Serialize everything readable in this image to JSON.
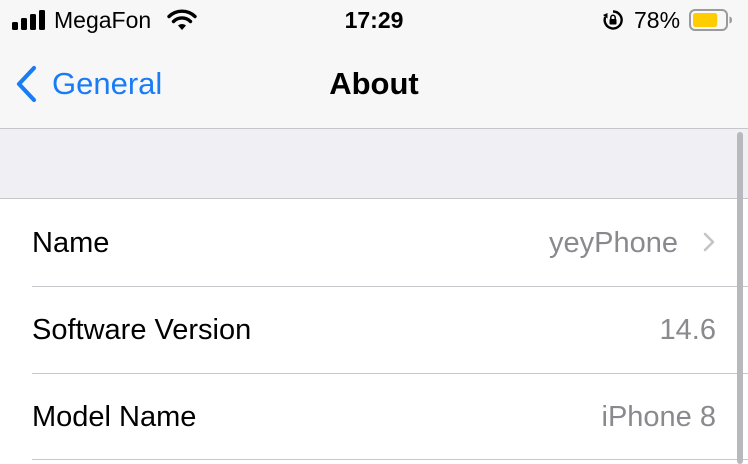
{
  "status_bar": {
    "carrier": "MegaFon",
    "time": "17:29",
    "battery_percent": "78%",
    "battery_level": 0.78,
    "battery_color": "#ffcc00",
    "icons": [
      "signal-icon",
      "wifi-icon",
      "rotation-lock-icon",
      "battery-icon"
    ]
  },
  "nav": {
    "back_label": "General",
    "title": "About",
    "accent_color": "#1a7cf5"
  },
  "rows": [
    {
      "label": "Name",
      "value": "yeyPhone",
      "has_chevron": true
    },
    {
      "label": "Software Version",
      "value": "14.6",
      "has_chevron": false
    },
    {
      "label": "Model Name",
      "value": "iPhone 8",
      "has_chevron": false
    }
  ]
}
